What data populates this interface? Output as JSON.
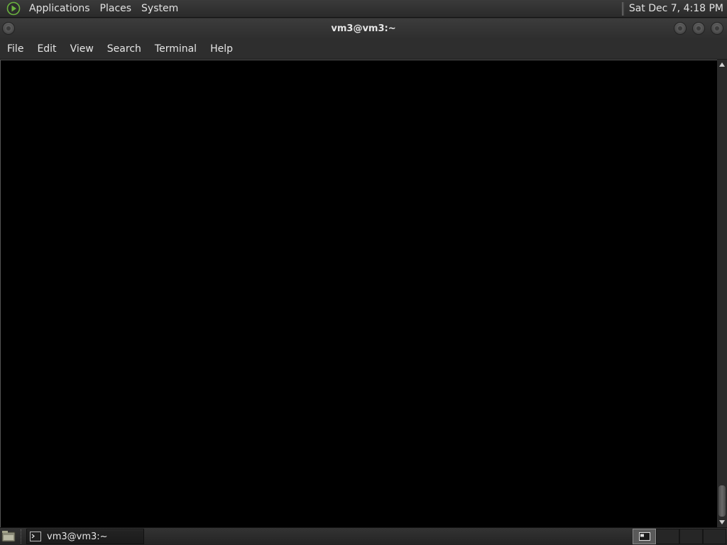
{
  "top_panel": {
    "menus": [
      "Applications",
      "Places",
      "System"
    ],
    "clock": "Sat Dec 7,  4:18 PM"
  },
  "window": {
    "title": "vm3@vm3:~"
  },
  "menubar": {
    "items": [
      "File",
      "Edit",
      "View",
      "Search",
      "Terminal",
      "Help"
    ]
  },
  "taskbar": {
    "tasks": [
      {
        "label": "vm3@vm3:~",
        "icon": "terminal-icon"
      }
    ],
    "workspaces": 4,
    "active_workspace": 1
  },
  "colors": {
    "terminal_background": "#000000",
    "panel_background": "#2e2e2e",
    "logo_accent": "#6bb33f"
  }
}
